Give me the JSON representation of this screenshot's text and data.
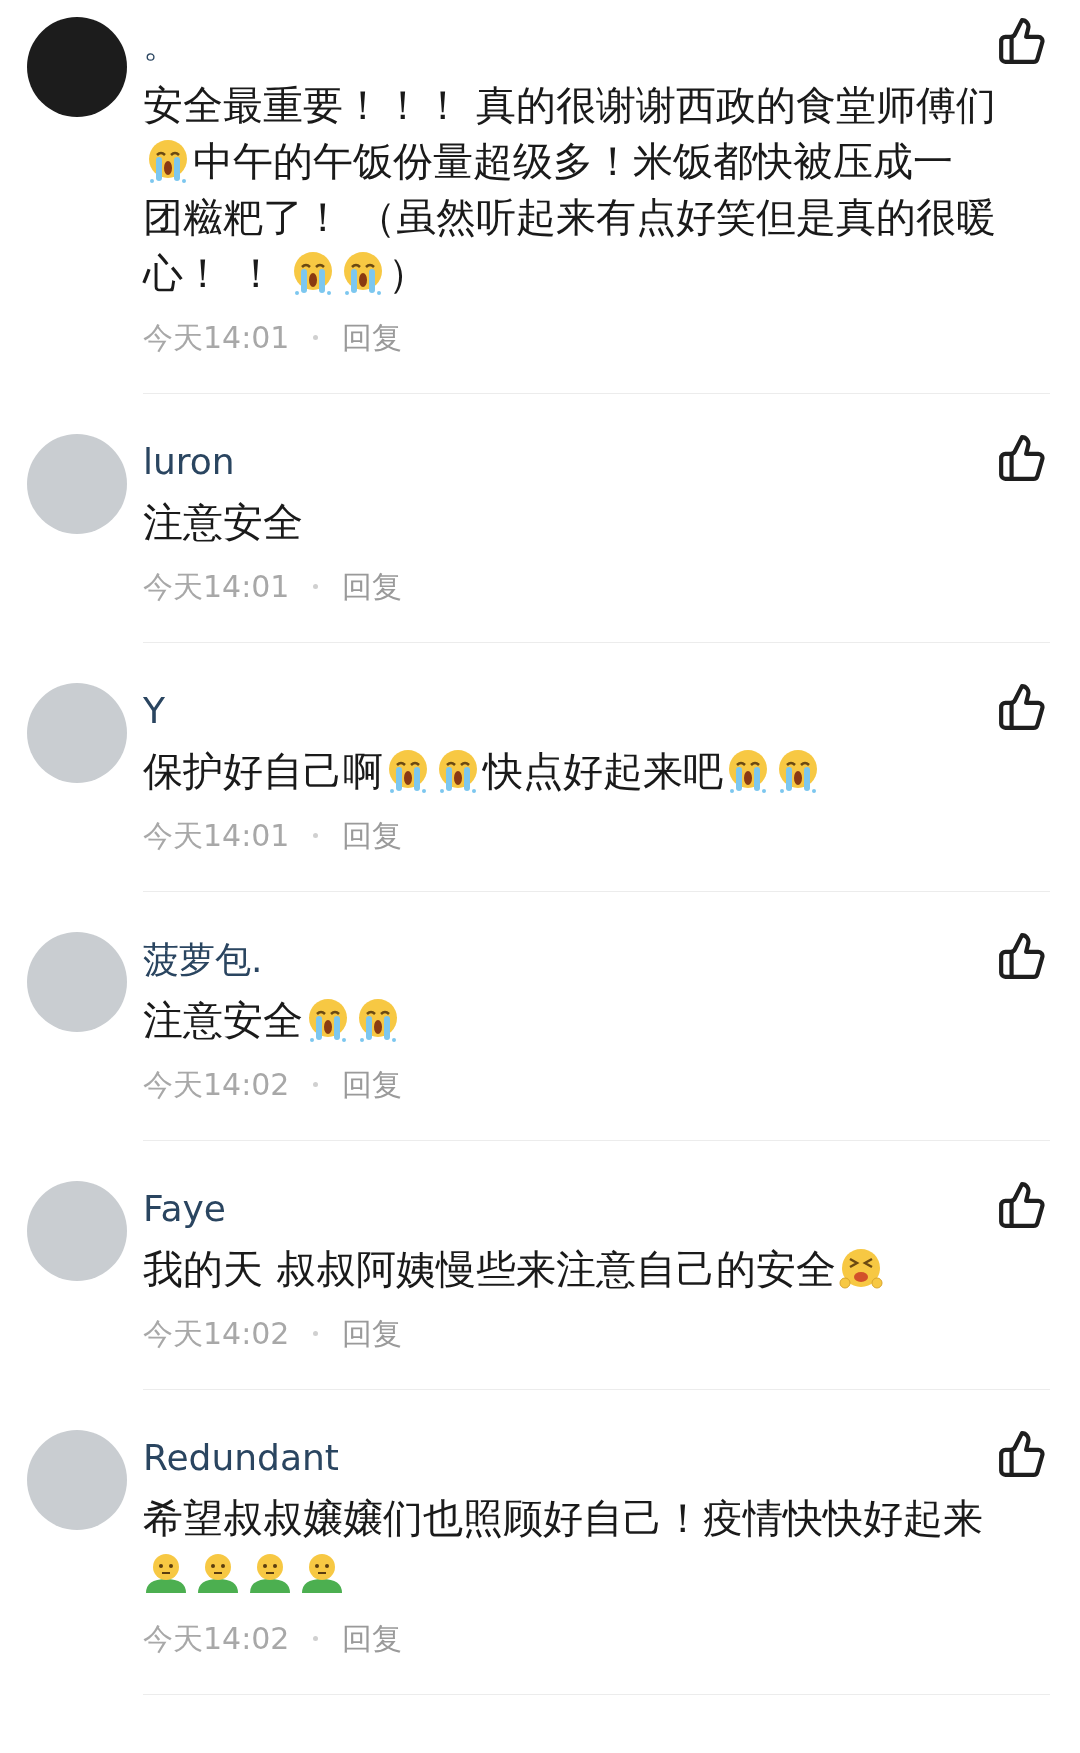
{
  "comments": [
    {
      "name": "。",
      "body": [
        [
          {
            "kind": "text",
            "text": "安全最重要！！！ 真的很谢谢西政的食堂师傅们"
          }
        ],
        [
          {
            "kind": "cry"
          },
          {
            "kind": "text",
            "text": "中午的午饭份量超级多！米饭都快被压成一"
          }
        ],
        [
          {
            "kind": "text",
            "text": "团糍粑了！ （虽然听起来有点好笑但是真的很暖"
          }
        ],
        [
          {
            "kind": "text",
            "text": "心！ ！ "
          },
          {
            "kind": "cry"
          },
          {
            "kind": "cry"
          },
          {
            "kind": "text",
            "text": "）"
          }
        ]
      ],
      "time": "今天14:01",
      "reply": "回复"
    },
    {
      "name": "luron",
      "body": [
        [
          {
            "kind": "text",
            "text": "注意安全"
          }
        ]
      ],
      "time": "今天14:01",
      "reply": "回复"
    },
    {
      "name": "Y",
      "body": [
        [
          {
            "kind": "text",
            "text": "保护好自己啊"
          },
          {
            "kind": "cry"
          },
          {
            "kind": "cry"
          },
          {
            "kind": "text",
            "text": "快点好起来吧"
          },
          {
            "kind": "cry"
          },
          {
            "kind": "cry"
          }
        ]
      ],
      "time": "今天14:01",
      "reply": "回复"
    },
    {
      "name": "菠萝包.",
      "body": [
        [
          {
            "kind": "text",
            "text": "注意安全"
          },
          {
            "kind": "cry"
          },
          {
            "kind": "cry"
          }
        ]
      ],
      "time": "今天14:02",
      "reply": "回复"
    },
    {
      "name": "Faye",
      "body": [
        [
          {
            "kind": "text",
            "text": "我的天 叔叔阿姨慢些来注意自己的安全"
          },
          {
            "kind": "grimace"
          }
        ]
      ],
      "time": "今天14:02",
      "reply": "回复"
    },
    {
      "name": "Redundant",
      "body": [
        [
          {
            "kind": "text",
            "text": "希望叔叔嬢嬢们也照顾好自己！疫情快快好起来"
          }
        ],
        [
          {
            "kind": "person"
          },
          {
            "kind": "person"
          },
          {
            "kind": "person"
          },
          {
            "kind": "person"
          }
        ]
      ],
      "time": "今天14:02",
      "reply": "回复"
    }
  ]
}
